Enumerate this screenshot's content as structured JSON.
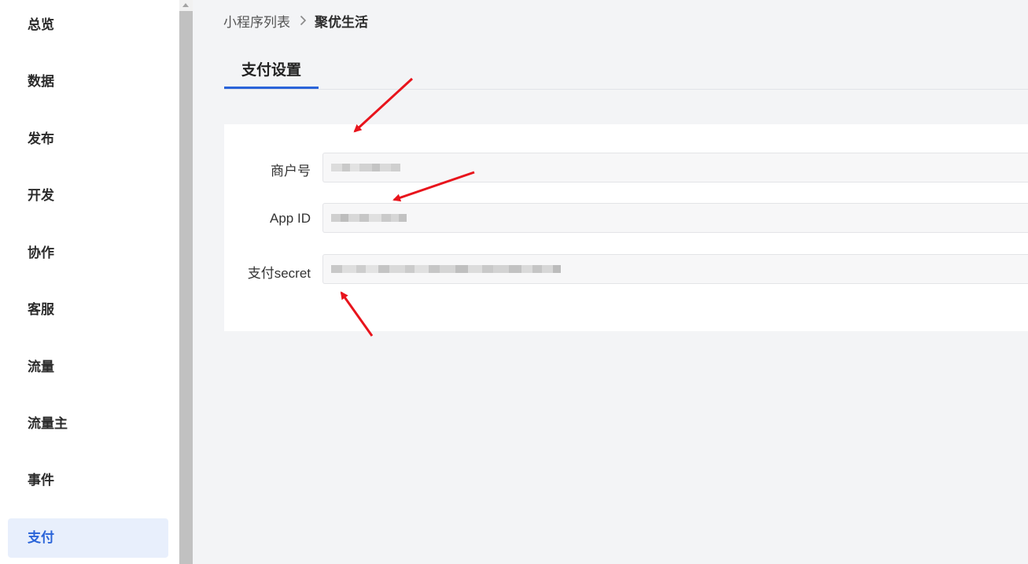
{
  "sidebar": {
    "items": [
      {
        "label": "总览",
        "active": false
      },
      {
        "label": "数据",
        "active": false
      },
      {
        "label": "发布",
        "active": false
      },
      {
        "label": "开发",
        "active": false
      },
      {
        "label": "协作",
        "active": false
      },
      {
        "label": "客服",
        "active": false
      },
      {
        "label": "流量",
        "active": false
      },
      {
        "label": "流量主",
        "active": false
      },
      {
        "label": "事件",
        "active": false
      },
      {
        "label": "支付",
        "active": true
      }
    ]
  },
  "breadcrumb": {
    "parent": "小程序列表",
    "current": "聚优生活"
  },
  "tabs": {
    "active_label": "支付设置"
  },
  "form": {
    "merchant_id_label": "商户号",
    "app_id_label": "App ID",
    "pay_secret_label": "支付secret"
  },
  "colors": {
    "accent": "#2a64d9",
    "annotation_arrow": "#e8141c"
  }
}
